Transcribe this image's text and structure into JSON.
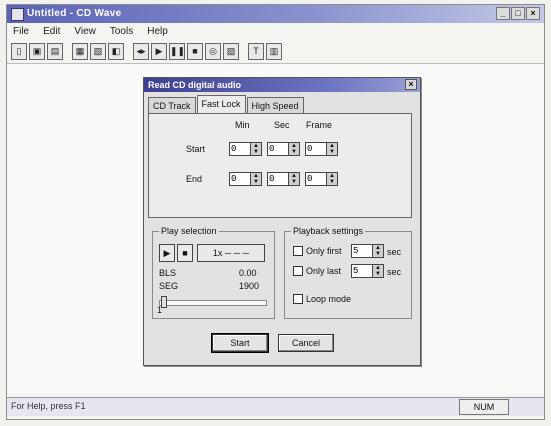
{
  "app": {
    "title": "Untitled - CD Wave",
    "window_buttons": {
      "minimize": "_",
      "maximize": "□",
      "close": "×"
    }
  },
  "menu": [
    "File",
    "Edit",
    "View",
    "Tools",
    "Help"
  ],
  "toolbar": {
    "buttons": [
      {
        "glyph": "▯",
        "icon": "new-icon"
      },
      {
        "glyph": "▣",
        "icon": "open-icon"
      },
      {
        "glyph": "▤",
        "icon": "save-icon"
      },
      {
        "glyph": "▦",
        "icon": "split-icon"
      },
      {
        "glyph": "▧",
        "icon": "cut-icon"
      },
      {
        "glyph": "◧",
        "icon": "copy-icon"
      },
      {
        "glyph": "◂▸",
        "icon": "rewind-icon"
      },
      {
        "glyph": "▶",
        "icon": "play-icon"
      },
      {
        "glyph": "❚❚",
        "icon": "pause-icon"
      },
      {
        "glyph": "■",
        "icon": "stop-icon"
      },
      {
        "glyph": "◎",
        "icon": "cd-icon"
      },
      {
        "glyph": "▨",
        "icon": "record-icon"
      },
      {
        "glyph": "T",
        "icon": "text-icon"
      },
      {
        "glyph": "▥",
        "icon": "tracks-icon"
      }
    ]
  },
  "dialog": {
    "title": "Read CD digital audio",
    "close_glyph": "×",
    "tabs": [
      "CD Track",
      "Fast Lock",
      "High Speed"
    ],
    "active_tab": 1,
    "columns": [
      "Min",
      "Sec",
      "Frame"
    ],
    "rows": [
      {
        "label": "Start",
        "values": [
          "0",
          "0",
          "0"
        ]
      },
      {
        "label": "End",
        "values": [
          "0",
          "0",
          "0"
        ]
      }
    ],
    "play_selection": {
      "label": "Play selection",
      "play_glyph": "▶",
      "stop_glyph": "■",
      "speed": "1x ─ ─ ─",
      "stats": [
        {
          "left": "BLS",
          "right": "0.00"
        },
        {
          "left": "SEG",
          "right": "1900"
        }
      ],
      "bottom_mark": "1"
    },
    "playback_settings": {
      "label": "Playback settings",
      "options": [
        {
          "text": "Only first",
          "value": "5",
          "unit": "sec"
        },
        {
          "text": "Only last",
          "value": "5",
          "unit": "sec"
        }
      ],
      "loop_label": "Loop mode"
    },
    "buttons": {
      "start": "Start",
      "cancel": "Cancel"
    }
  },
  "status": {
    "text": "For Help, press F1",
    "mode": "NUM"
  }
}
